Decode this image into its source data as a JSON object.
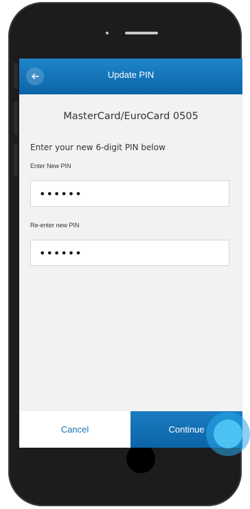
{
  "header": {
    "title": "Update PIN",
    "back_icon": "arrow-left-icon"
  },
  "card": {
    "title": "MasterCard/EuroCard 0505"
  },
  "form": {
    "instruction": "Enter your new 6-digit PIN below",
    "new_pin_label": "Enter New PIN",
    "new_pin_value": "••••••",
    "reenter_pin_label": "Re-enter new PIN",
    "reenter_pin_value": "••••••"
  },
  "footer": {
    "cancel_label": "Cancel",
    "continue_label": "Continue"
  },
  "colors": {
    "header_blue": "#0b65a8",
    "continue_blue": "#0c64a6",
    "cancel_text": "#1a73b8",
    "touch_indicator": "#4cc2f2"
  }
}
